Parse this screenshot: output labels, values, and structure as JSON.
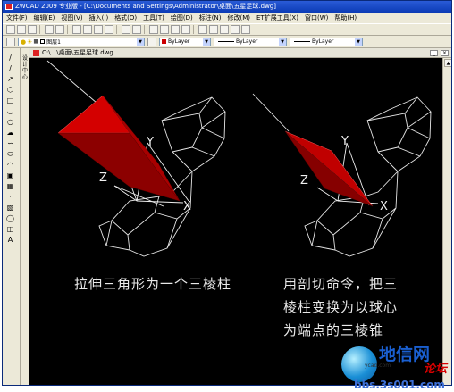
{
  "window": {
    "title": "ZWCAD 2009 专业版 - [C:\\Documents and Settings\\Administrator\\桌面\\五星足球.dwg]"
  },
  "menu": [
    "文件(F)",
    "编辑(E)",
    "视图(V)",
    "插入(I)",
    "格式(O)",
    "工具(T)",
    "绘图(D)",
    "标注(N)",
    "修改(M)",
    "ET扩展工具(X)",
    "窗口(W)",
    "帮助(H)"
  ],
  "layer_bar": {
    "layer_value": "图层1",
    "color_value": "ByLayer",
    "linetype_value": "ByLayer",
    "lineweight_value": "ByLayer"
  },
  "side_panel": {
    "label": "设计中心"
  },
  "document": {
    "title": "C:\\...\\桌面\\五星足球.dwg"
  },
  "drawing": {
    "left_caption": "拉伸三角形为一个三棱柱",
    "right_caption_lines": [
      "用剖切命令，把三",
      "棱柱变换为以球心",
      "为端点的三棱锥"
    ],
    "axis_labels": {
      "y": "Y",
      "z": "Z",
      "x": "X"
    },
    "solid_color": "#c80000",
    "wire_color": "#e6e6e6"
  },
  "watermark": {
    "brand": "地信网",
    "domain_small": "ycad.com",
    "forum": "论坛",
    "url": "bbs.3s001.com"
  }
}
